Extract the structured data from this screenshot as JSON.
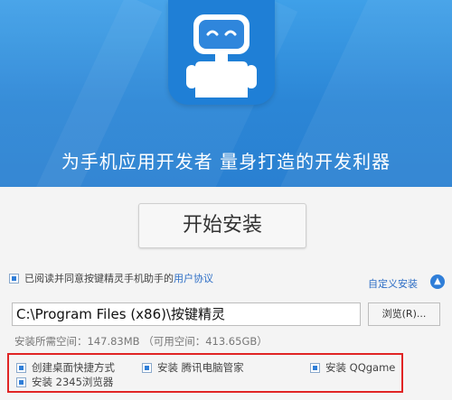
{
  "hero": {
    "tagline": "为手机应用开发者 量身打造的开发利器"
  },
  "install_button": {
    "label": "开始安装"
  },
  "agreement": {
    "text": "已阅读并同意按键精灵手机助手的",
    "link": "用户协议"
  },
  "custom_install": {
    "label": "自定义安装"
  },
  "install_path": {
    "value": "C:\\Program Files (x86)\\按键精灵"
  },
  "browse_button": {
    "label": "浏览(R)..."
  },
  "space_info": {
    "text": "安装所需空间：147.83MB （可用空间：413.65GB）"
  },
  "options": [
    {
      "label": "创建桌面快捷方式",
      "checked": true
    },
    {
      "label": "安装 腾讯电脑管家",
      "checked": true
    },
    {
      "label": "安装 QQgame",
      "checked": true
    },
    {
      "label": "安装 2345浏览器",
      "checked": true
    }
  ],
  "colors": {
    "hero_blue": "#2b86d6",
    "accent": "#2f7ed8",
    "highlight_border": "#e02424"
  }
}
